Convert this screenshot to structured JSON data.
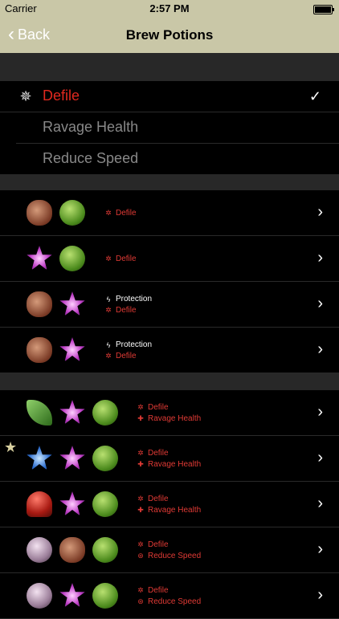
{
  "status": {
    "carrier": "Carrier",
    "time": "2:57 PM"
  },
  "nav": {
    "back_label": "Back",
    "title": "Brew Potions"
  },
  "filters": [
    {
      "label": "Defile",
      "selected": true
    },
    {
      "label": "Ravage Health",
      "selected": false
    },
    {
      "label": "Reduce Speed",
      "selected": false
    }
  ],
  "sections": [
    {
      "recipes": [
        {
          "starred": false,
          "ingredients": [
            "nut-icon",
            "cabbage-icon"
          ],
          "effects": [
            {
              "icon": "defile-icon",
              "label": "Defile",
              "color": "red"
            }
          ]
        },
        {
          "starred": false,
          "ingredients": [
            "purple-flower-icon",
            "cabbage-icon"
          ],
          "effects": [
            {
              "icon": "defile-icon",
              "label": "Defile",
              "color": "red"
            }
          ]
        },
        {
          "starred": false,
          "ingredients": [
            "nut-icon",
            "purple-flower-icon"
          ],
          "effects": [
            {
              "icon": "lightning-icon",
              "label": "Protection",
              "color": "white"
            },
            {
              "icon": "defile-icon",
              "label": "Defile",
              "color": "red"
            }
          ]
        },
        {
          "starred": false,
          "ingredients": [
            "nut-icon",
            "purple-flower-icon"
          ],
          "effects": [
            {
              "icon": "lightning-icon",
              "label": "Protection",
              "color": "white"
            },
            {
              "icon": "defile-icon",
              "label": "Defile",
              "color": "red"
            }
          ]
        }
      ]
    },
    {
      "recipes": [
        {
          "starred": false,
          "ingredients": [
            "leaf-icon",
            "purple-flower-icon",
            "cabbage-icon"
          ],
          "effects": [
            {
              "icon": "defile-icon",
              "label": "Defile",
              "color": "red"
            },
            {
              "icon": "cross-icon",
              "label": "Ravage Health",
              "color": "red"
            }
          ]
        },
        {
          "starred": true,
          "ingredients": [
            "blue-flower-icon",
            "purple-flower-icon",
            "cabbage-icon"
          ],
          "effects": [
            {
              "icon": "defile-icon",
              "label": "Defile",
              "color": "red"
            },
            {
              "icon": "cross-icon",
              "label": "Ravage Health",
              "color": "red"
            }
          ]
        },
        {
          "starred": false,
          "ingredients": [
            "mushroom-icon",
            "purple-flower-icon",
            "cabbage-icon"
          ],
          "effects": [
            {
              "icon": "defile-icon",
              "label": "Defile",
              "color": "red"
            },
            {
              "icon": "cross-icon",
              "label": "Ravage Health",
              "color": "red"
            }
          ]
        },
        {
          "starred": false,
          "ingredients": [
            "pebble-icon",
            "nut-icon",
            "cabbage-icon"
          ],
          "effects": [
            {
              "icon": "defile-icon",
              "label": "Defile",
              "color": "red"
            },
            {
              "icon": "swirl-icon",
              "label": "Reduce Speed",
              "color": "red"
            }
          ]
        },
        {
          "starred": false,
          "ingredients": [
            "pebble-icon",
            "purple-flower-icon",
            "cabbage-icon"
          ],
          "effects": [
            {
              "icon": "defile-icon",
              "label": "Defile",
              "color": "red"
            },
            {
              "icon": "swirl-icon",
              "label": "Reduce Speed",
              "color": "red"
            }
          ]
        }
      ]
    }
  ],
  "colors": {
    "navbar": "#c9c7a7",
    "accent_red": "#e0281e",
    "background": "#000000"
  }
}
